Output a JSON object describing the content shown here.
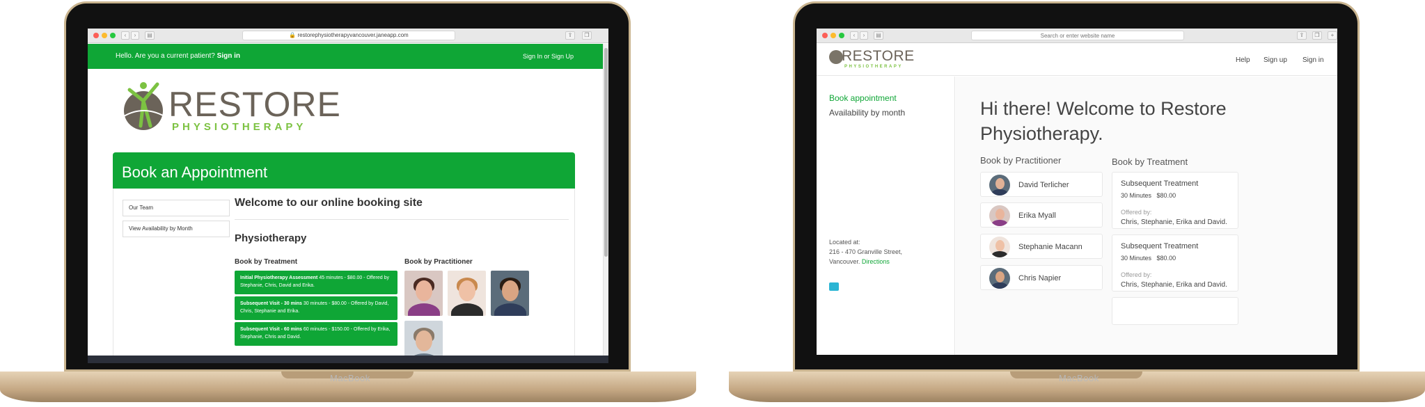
{
  "left_device": {
    "brand": "MacBook",
    "browser": {
      "url": "restorephysiotherapyvancouver.janeapp.com"
    },
    "topbar": {
      "hello": "Hello. Are you a current patient?",
      "sign_in": "Sign in",
      "sign_up": "Sign In or Sign Up"
    },
    "logo": {
      "word": "RESTORE",
      "sub": "PHYSIOTHERAPY"
    },
    "booking": {
      "header": "Book an Appointment",
      "sidebar": [
        "Our Team",
        "View Availability by Month"
      ],
      "welcome": "Welcome to our online booking site",
      "section": "Physiotherapy",
      "col_treatment": "Book by Treatment",
      "col_practitioner": "Book by Practitioner",
      "treatments": [
        {
          "name": "Initial Physiotherapy Assessment",
          "detail": "45 minutes - $80.00 - Offered by Stephanie, Chris, David and Erika."
        },
        {
          "name": "Subsequent Visit - 30 mins",
          "detail": "30 minutes - $80.00 - Offered by David, Chris, Stephanie and Erika."
        },
        {
          "name": "Subsequent Visit - 60 mins",
          "detail": "60 minutes - $150.00 - Offered by Erika, Stephanie, Chris and David."
        }
      ]
    }
  },
  "right_device": {
    "brand": "MacBook",
    "browser": {
      "url_placeholder": "Search or enter website name"
    },
    "logo": {
      "word": "RESTORE",
      "sub": "PHYSIOTHERAPY"
    },
    "nav": [
      "Help",
      "Sign up",
      "Sign in"
    ],
    "sidebar": {
      "links": [
        "Book appointment",
        "Availability by month"
      ],
      "located_label": "Located at:",
      "address_line1": "216 - 470 Granville Street,",
      "address_line2": "Vancouver.",
      "directions": "Directions"
    },
    "main": {
      "greeting": "Hi there! Welcome to Restore Physiotherapy.",
      "col_practitioner": "Book by Practitioner",
      "col_treatment": "Book by Treatment",
      "practitioners": [
        "David Terlicher",
        "Erika Myall",
        "Stephanie Macann",
        "Chris Napier"
      ],
      "treatments": [
        {
          "title": "Subsequent Treatment",
          "duration": "30 Minutes",
          "price": "$80.00",
          "offered_label": "Offered by:",
          "offered_by": "Chris, Stephanie, Erika and David."
        },
        {
          "title": "Subsequent Treatment",
          "duration": "30 Minutes",
          "price": "$80.00",
          "offered_label": "Offered by:",
          "offered_by": "Chris, Stephanie, Erika and David."
        }
      ]
    }
  },
  "colors": {
    "jane_green": "#0fa636",
    "logo_green": "#7cc242",
    "logo_grey": "#6b6359"
  }
}
